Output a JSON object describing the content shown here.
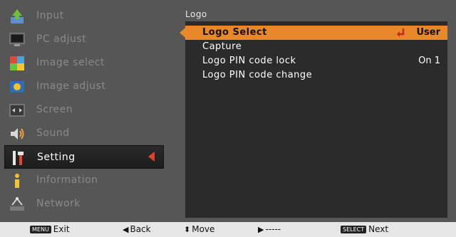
{
  "sidebar": {
    "items": [
      {
        "label": "Input",
        "icon": "input-icon"
      },
      {
        "label": "PC adjust",
        "icon": "pc-adjust-icon"
      },
      {
        "label": "Image select",
        "icon": "image-select-icon"
      },
      {
        "label": "Image adjust",
        "icon": "image-adjust-icon"
      },
      {
        "label": "Screen",
        "icon": "screen-icon"
      },
      {
        "label": "Sound",
        "icon": "sound-icon"
      },
      {
        "label": "Setting",
        "icon": "setting-icon",
        "active": true
      },
      {
        "label": "Information",
        "icon": "information-icon"
      },
      {
        "label": "Network",
        "icon": "network-icon"
      }
    ]
  },
  "panel": {
    "title": "Logo",
    "rows": [
      {
        "label": "Logo Select",
        "value": "User",
        "selected": true
      },
      {
        "label": "Capture",
        "value": ""
      },
      {
        "label": "Logo PIN code lock",
        "value": "On 1"
      },
      {
        "label": "Logo PIN code change",
        "value": ""
      }
    ]
  },
  "helpbar": {
    "exit": {
      "key": "MENU",
      "label": "Exit"
    },
    "back": {
      "glyph": "◀",
      "label": "Back"
    },
    "move": {
      "glyph": "⬍",
      "label": "Move"
    },
    "next_arrow": {
      "glyph": "▶",
      "label": "-----"
    },
    "next": {
      "key": "SELECT",
      "label": "Next"
    }
  },
  "colors": {
    "frame": "#565656",
    "panel_body": "#2b2b2b",
    "highlight": "#e8882b",
    "active_arrow": "#e0432a"
  }
}
